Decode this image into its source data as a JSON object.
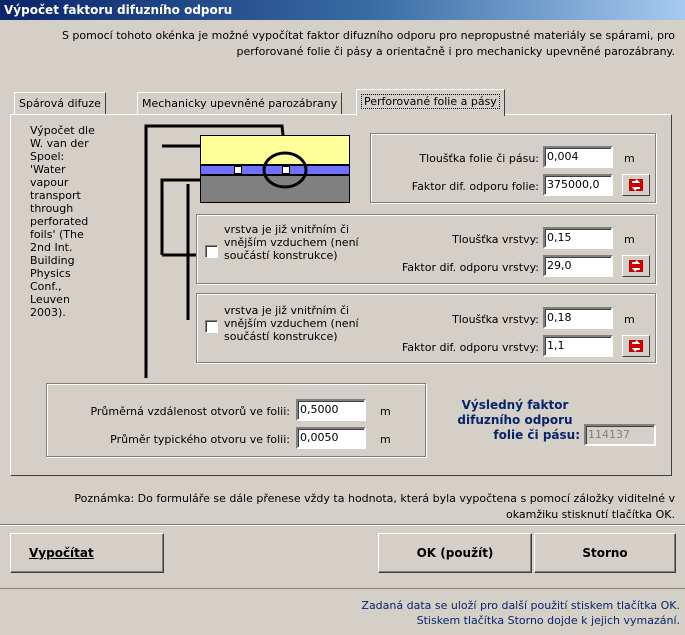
{
  "window": {
    "title": "Výpočet faktoru difuzního odporu"
  },
  "intro": {
    "line1": "S pomocí tohoto okénka je možné vypočítat faktor difuzního odporu pro nepropustné materiály se spárami, pro",
    "line2": "perforované folie či pásy a orientačně i pro mechanicky upevněné parozábrany."
  },
  "tabs": [
    {
      "label": "Spárová difuze"
    },
    {
      "label": "Mechanicky upevněné parozábrany"
    },
    {
      "label": "Perforované folie a pásy"
    }
  ],
  "description": "Výpočet dle W. van der Spoel: 'Water vapour transport through perforated foils' (The 2nd Int. Building Physics Conf., Leuven 2003).",
  "foil": {
    "thickness_label": "Tloušťka folie či pásu:",
    "thickness_value": "0,004",
    "factor_label": "Faktor dif. odporu folie:",
    "factor_value": "375000,0",
    "unit": "m"
  },
  "layer1": {
    "checkbox_label": "vrstva je již vnitřním či vnějším vzduchem (není součástí konstrukce)",
    "thickness_label": "Tloušťka vrstvy:",
    "thickness_value": "0,15",
    "factor_label": "Faktor dif. odporu vrstvy:",
    "factor_value": "29,0",
    "unit": "m"
  },
  "layer2": {
    "checkbox_label": "vrstva je již vnitřním či vnějším vzduchem (není součástí konstrukce)",
    "thickness_label": "Tloušťka vrstvy:",
    "thickness_value": "0,18",
    "factor_label": "Faktor dif. odporu vrstvy:",
    "factor_value": "1,1",
    "unit": "m"
  },
  "holes": {
    "distance_label": "Průměrná vzdálenost otvorů ve folii:",
    "distance_value": "0,5000",
    "diameter_label": "Průměr typického otvoru ve folii:",
    "diameter_value": "0,0050",
    "unit": "m"
  },
  "result": {
    "label_line1": "Výsledný faktor",
    "label_line2": "difuzního odporu",
    "label_line3": "folie či pásu:",
    "value": "114137"
  },
  "note": {
    "line1": "Poznámka: Do formuláře se dále přenese vždy ta hodnota, která byla vypočtena s pomocí záložky viditelné v",
    "line2": "okamžiku stisknutí tlačítka OK."
  },
  "buttons": {
    "calculate": "Vypočítat",
    "ok": "OK (použít)",
    "cancel": "Storno"
  },
  "footer": {
    "line1": "Zadaná data se uloží pro další použití stiskem tlačítka OK.",
    "line2": "Stiskem tlačítka Storno dojde k jejich vymazání."
  },
  "icons": {
    "calc_button_icon": "calculator-arrow-icon",
    "checkbox_icon": "checkbox-icon"
  },
  "colors": {
    "title_bar": "#0a246a",
    "foil_yellow": "#ffff99",
    "foil_blue": "#7070ff",
    "layer_grey": "#808080",
    "calc_red": "#cc0000"
  }
}
